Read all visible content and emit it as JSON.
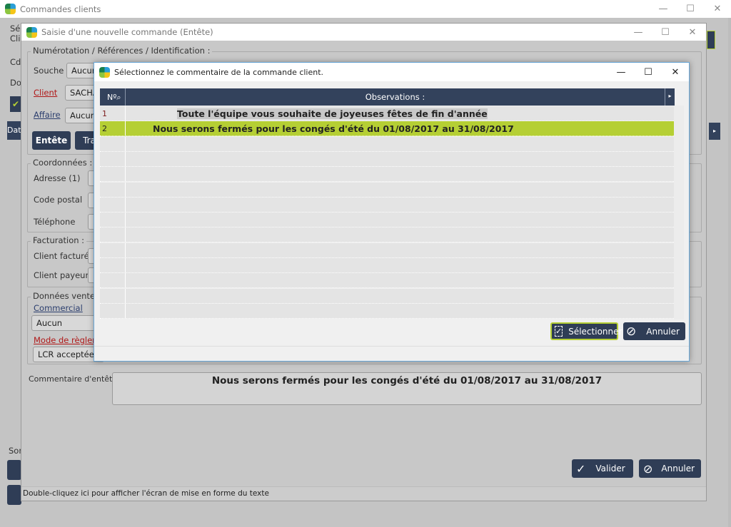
{
  "outer_window": {
    "title": "Commandes clients",
    "partial_labels": [
      "Sél",
      "Cli",
      "Cde",
      "Dos",
      "Dat",
      "Som"
    ]
  },
  "order_window": {
    "title": "Saisie d'une nouvelle commande (Entête)",
    "ident_group": "Numérotation / Références / Identification :",
    "souche_label": "Souche",
    "souche_value": "Aucun",
    "client_label": "Client",
    "client_value": "SACHA",
    "affaire_label": "Affaire",
    "affaire_value": "Aucun",
    "tabs": [
      "Entête",
      "Tra"
    ],
    "coord_group": "Coordonnées :",
    "adresse_label": "Adresse (1)",
    "cp_label": "Code postal",
    "tel_label": "Téléphone",
    "fact_group": "Facturation :",
    "client_facture_label": "Client facturé",
    "client_payeur_label": "Client payeur",
    "ventes_group": "Données ventes :",
    "commercial_label": "Commercial",
    "commercial_value": "Aucun",
    "reglement_label": "Mode de règleme",
    "reglement_value": "LCR acceptée",
    "comment_label": "Commentaire d'entête",
    "comment_value": "Nous serons fermés pour les congés d'été du 01/08/2017 au 31/08/2017",
    "valider": "Valider",
    "annuler": "Annuler",
    "status": "Double-cliquez ici pour afficher l'écran de mise en forme du texte"
  },
  "dialog": {
    "title": "Sélectionnez le commentaire de la commande client.",
    "columns": [
      "Nº",
      "Observations :"
    ],
    "rows": [
      {
        "num": "1",
        "text": "Toute l'équipe vous souhaite de joyeuses fêtes de fin d'année",
        "selected": false
      },
      {
        "num": "2",
        "text": "Nous serons fermés pour les congés d'été du 01/08/2017 au 31/08/2017",
        "selected": true
      }
    ],
    "select_button": "Sélectionner",
    "cancel_button": "Annuler"
  },
  "colors": {
    "header": "#33425c",
    "selection": "#b5cf34",
    "button": "#2f3d56"
  }
}
